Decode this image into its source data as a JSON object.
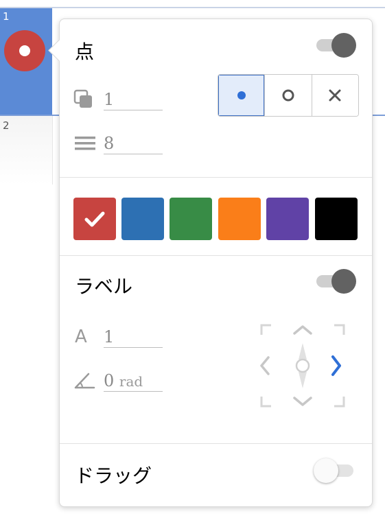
{
  "list": {
    "row1_index": "1",
    "row2_index": "2"
  },
  "colors": {
    "selection_blue": "#5b8ad6",
    "point_red": "#c74440",
    "accent_blue": "#2f6fd6"
  },
  "point": {
    "title": "点",
    "enabled": true,
    "opacity_value": "1",
    "size_value": "8",
    "opacity_icon": "layers-icon",
    "size_icon": "lines-icon",
    "styles": [
      {
        "name": "filled-point",
        "glyph": "●",
        "selected": true
      },
      {
        "name": "open-point",
        "glyph": "○",
        "selected": false
      },
      {
        "name": "cross-point",
        "glyph": "✕",
        "selected": false
      }
    ]
  },
  "palette": {
    "selected_index": 0,
    "swatches": [
      "#c74440",
      "#2d70b3",
      "#388c46",
      "#fa7e19",
      "#6042a6",
      "#000000"
    ]
  },
  "label": {
    "title": "ラベル",
    "enabled": true,
    "size_icon_text": "A",
    "size_value": "1",
    "angle_value": "0",
    "angle_unit": "rad",
    "position_selected": "right"
  },
  "drag": {
    "title": "ドラッグ",
    "enabled": false
  }
}
